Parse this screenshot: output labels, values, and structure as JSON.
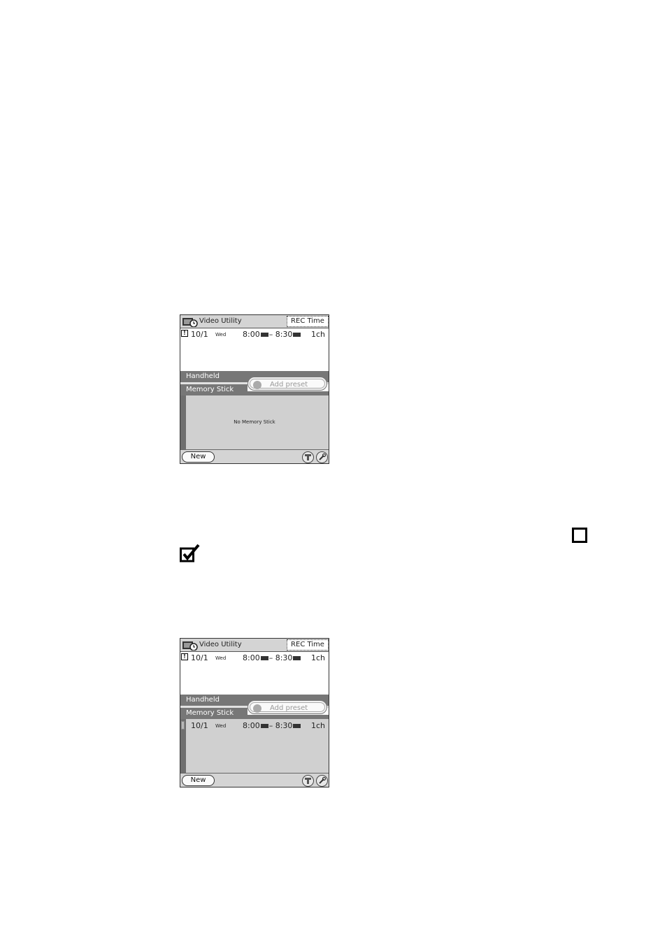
{
  "screen1": {
    "title": "Video Utility",
    "rec_time": "REC Time",
    "entry": {
      "warn": "!",
      "date": "10/1",
      "day": "Wed",
      "start": "8:00",
      "dash": "–",
      "end": "8:30",
      "channel": "1ch"
    },
    "tab_handheld": "Handheld",
    "tab_memory_stick": "Memory Stick",
    "add_preset": "Add preset",
    "no_memory_stick": "No Memory Stick",
    "new_button": "New"
  },
  "screen2": {
    "title": "Video Utility",
    "rec_time": "REC Time",
    "entry": {
      "warn": "!",
      "date": "10/1",
      "day": "Wed",
      "start": "8:00",
      "dash": "–",
      "end": "8:30",
      "channel": "1ch"
    },
    "tab_handheld": "Handheld",
    "tab_memory_stick": "Memory Stick",
    "add_preset": "Add preset",
    "ms_entry": {
      "date": "10/1",
      "day": "Wed",
      "start": "8:00",
      "dash": "–",
      "end": "8:30",
      "channel": "1ch"
    },
    "new_button": "New"
  },
  "icons": {
    "app": "video-recorder-icon",
    "info": "info-icon",
    "settings": "wrench-icon",
    "checkbox_empty": "checkbox-empty-icon",
    "checkbox_checked": "checkbox-checked-icon"
  },
  "colors": {
    "header_bg": "#d4d4d4",
    "tab_bg": "#777777",
    "list_bg": "#d0d0d0"
  }
}
